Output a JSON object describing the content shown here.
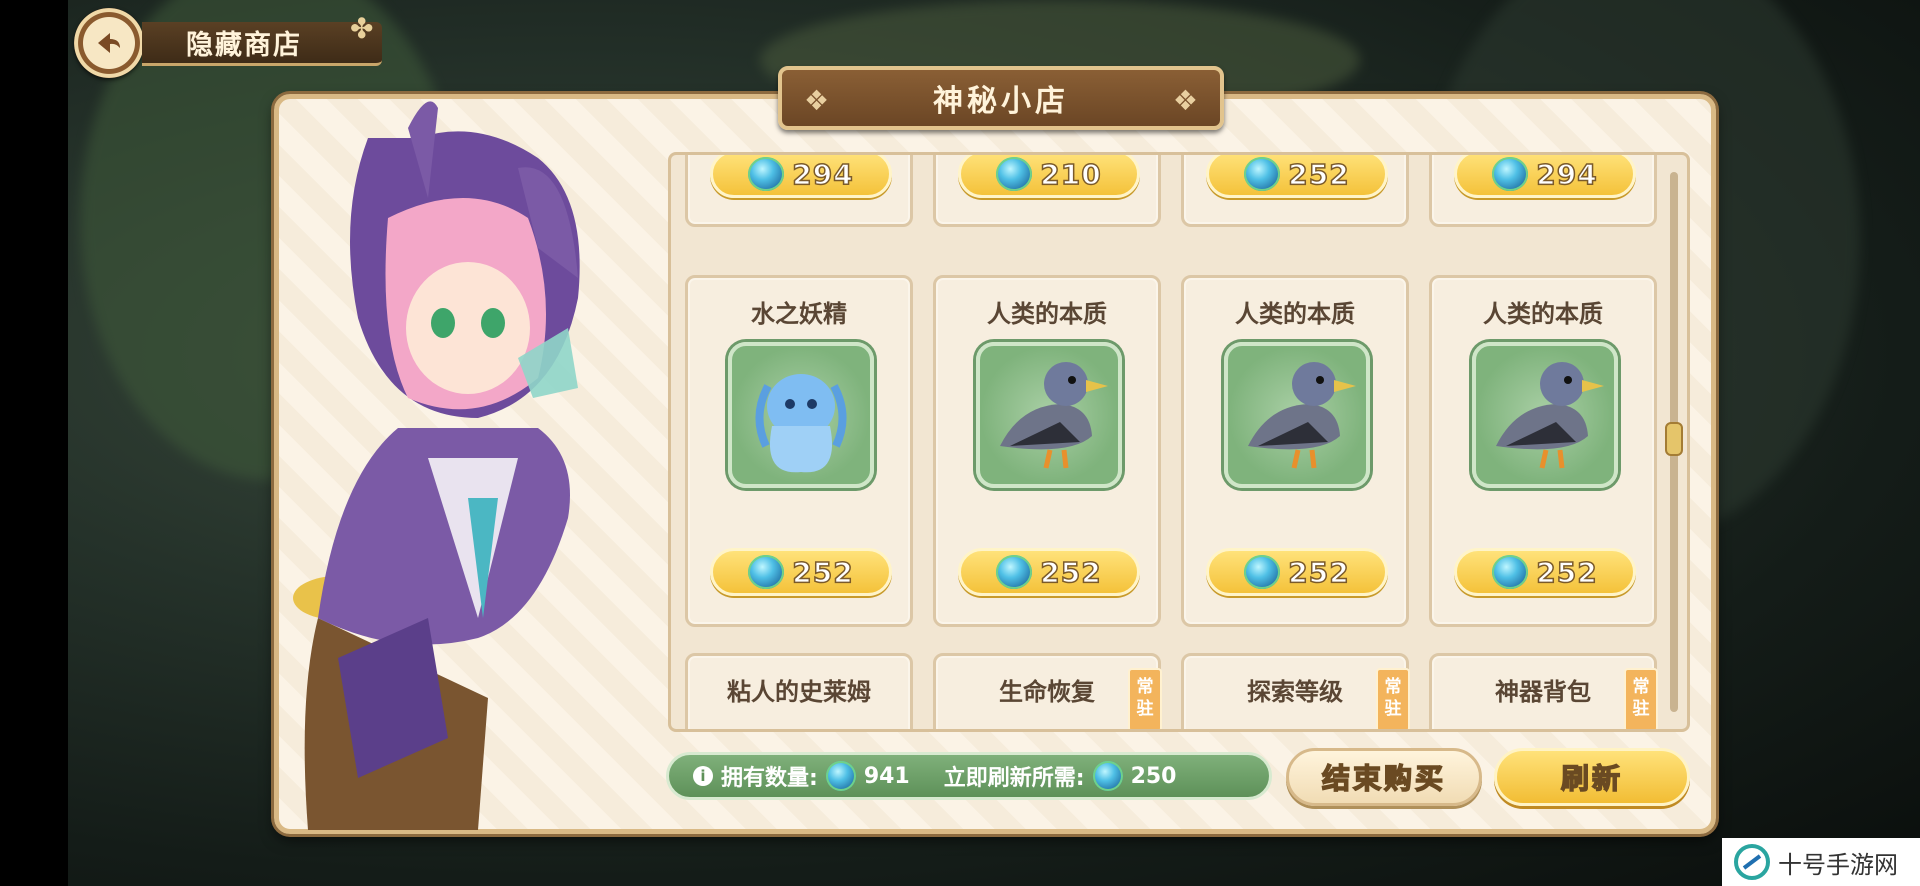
{
  "header": {
    "title": "隐藏商店"
  },
  "shop": {
    "title": "神秘小店"
  },
  "top_row": [
    {
      "price": "294"
    },
    {
      "price": "210"
    },
    {
      "price": "252"
    },
    {
      "price": "294"
    }
  ],
  "mid_row": [
    {
      "name": "水之妖精",
      "price": "252",
      "icon": "water-fairy-icon"
    },
    {
      "name": "人类的本质",
      "price": "252",
      "icon": "pigeon-icon"
    },
    {
      "name": "人类的本质",
      "price": "252",
      "icon": "pigeon-icon"
    },
    {
      "name": "人类的本质",
      "price": "252",
      "icon": "pigeon-icon"
    }
  ],
  "bottom_row": [
    {
      "name": "粘人的史莱姆",
      "tag": ""
    },
    {
      "name": "生命恢复",
      "tag": "常驻"
    },
    {
      "name": "探索等级",
      "tag": "常驻"
    },
    {
      "name": "神器背包",
      "tag": "常驻"
    }
  ],
  "info": {
    "owned_label": "拥有数量:",
    "owned_value": "941",
    "refresh_label": "立即刷新所需:",
    "refresh_value": "250"
  },
  "buttons": {
    "end": "结束购买",
    "refresh": "刷新"
  },
  "watermark": {
    "text": "十号手游网"
  },
  "colors": {
    "gold": "#f4c23a",
    "green": "#5e9159",
    "panel": "#fbf3e6",
    "banner": "#6b4625"
  }
}
